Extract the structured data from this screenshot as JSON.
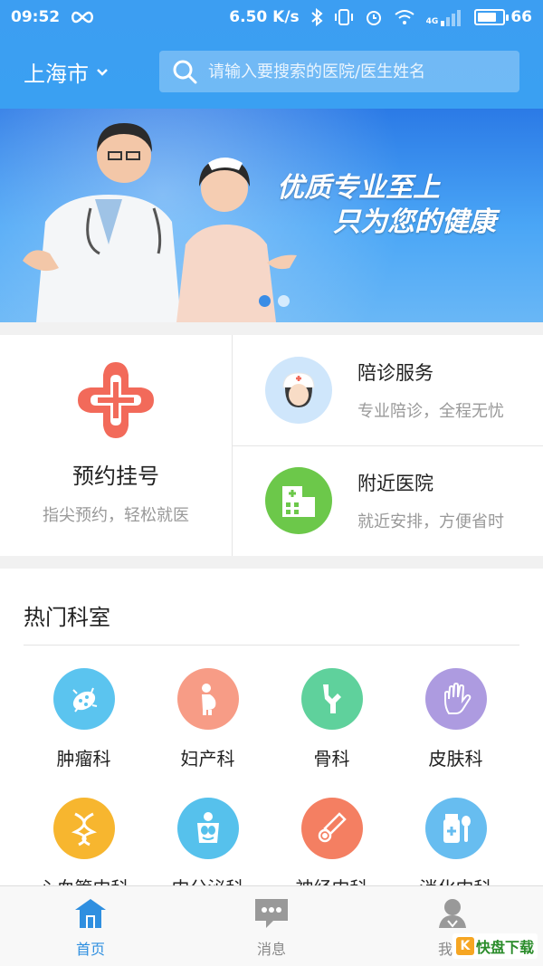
{
  "status_bar": {
    "time": "09:52",
    "speed": "6.50 K/s",
    "network": "4G",
    "battery": "66",
    "battery_level": 0.66
  },
  "header": {
    "city": "上海市",
    "search_placeholder": "请输入要搜索的医院/医生姓名"
  },
  "banner": {
    "line1": "优质专业至上",
    "line2": "只为您的健康",
    "slide_count": 2,
    "active_slide": 1
  },
  "services": {
    "main": {
      "title": "预约挂号",
      "subtitle": "指尖预约，轻松就医",
      "icon": "red-cross-icon"
    },
    "escort": {
      "title": "陪诊服务",
      "subtitle": "专业陪诊，全程无忧",
      "icon": "nurse-icon"
    },
    "nearby": {
      "title": "附近医院",
      "subtitle": "就近安排，方便省时",
      "icon": "hospital-building-icon"
    }
  },
  "departments": {
    "title": "热门科室",
    "items": [
      {
        "label": "肿瘤科",
        "icon": "virus-icon",
        "color": "#5bc4ef"
      },
      {
        "label": "妇产科",
        "icon": "pregnant-icon",
        "color": "#f79c86"
      },
      {
        "label": "骨科",
        "icon": "bone-icon",
        "color": "#5fd19c"
      },
      {
        "label": "皮肤科",
        "icon": "hand-icon",
        "color": "#ad9be0"
      },
      {
        "label": "心血管内科",
        "icon": "dna-icon",
        "color": "#f7b62f"
      },
      {
        "label": "内分泌科",
        "icon": "body-organs-icon",
        "color": "#56c1ec"
      },
      {
        "label": "神经内科",
        "icon": "thermometer-icon",
        "color": "#f47f62"
      },
      {
        "label": "消化内科",
        "icon": "medicine-bottle-icon",
        "color": "#67bdf0"
      }
    ]
  },
  "tabbar": {
    "items": [
      {
        "label": "首页",
        "icon": "home-icon",
        "active": true
      },
      {
        "label": "消息",
        "icon": "message-icon",
        "active": false
      },
      {
        "label": "我的",
        "icon": "profile-icon",
        "active": false
      }
    ]
  },
  "watermark": {
    "text": "快盘下载"
  },
  "colors": {
    "primary": "#3a9cf2",
    "accent_red": "#f26a5a",
    "accent_green": "#6cc84a"
  }
}
